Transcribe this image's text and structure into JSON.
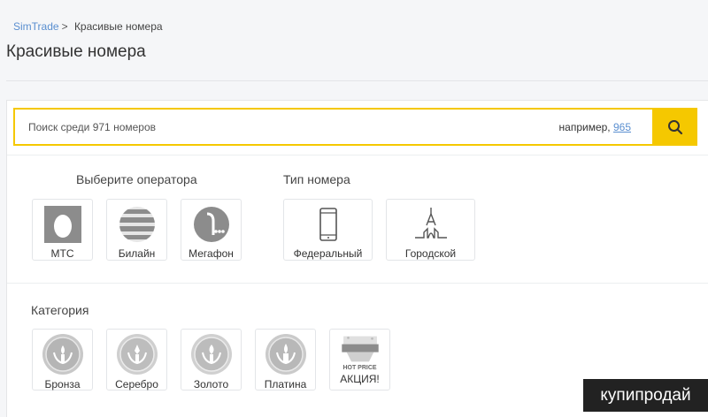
{
  "breadcrumb": {
    "home": "SimTrade",
    "separator": ">",
    "current": "Красивые номера"
  },
  "page": {
    "title": "Красивые номера"
  },
  "search": {
    "placeholder": "Поиск среди 971 номеров",
    "hint_prefix": "например,",
    "hint_example": "965",
    "button_icon": "search-icon"
  },
  "operators": {
    "title": "Выберите оператора",
    "items": [
      {
        "label": "МТС",
        "icon": "mts-logo-icon"
      },
      {
        "label": "Билайн",
        "icon": "beeline-logo-icon"
      },
      {
        "label": "Мегафон",
        "icon": "megafon-logo-icon"
      }
    ]
  },
  "number_type": {
    "title": "Тип номера",
    "items": [
      {
        "label": "Федеральный",
        "icon": "mobile-phone-icon"
      },
      {
        "label": "Городской",
        "icon": "city-tower-icon"
      }
    ]
  },
  "categories": {
    "title": "Категория",
    "items": [
      {
        "label": "Бронза",
        "icon": "bronze-medal-icon"
      },
      {
        "label": "Серебро",
        "icon": "silver-medal-icon"
      },
      {
        "label": "Золото",
        "icon": "gold-medal-icon"
      },
      {
        "label": "Платина",
        "icon": "platinum-medal-icon"
      },
      {
        "label": "АКЦИЯ!",
        "icon": "hot-price-icon",
        "badge_text": "HOT PRICE"
      }
    ]
  },
  "watermark": {
    "text": "купипродай"
  },
  "colors": {
    "accent": "#f5c800",
    "link": "#5a8fd0",
    "icon_gray": "#8c8c8c"
  }
}
